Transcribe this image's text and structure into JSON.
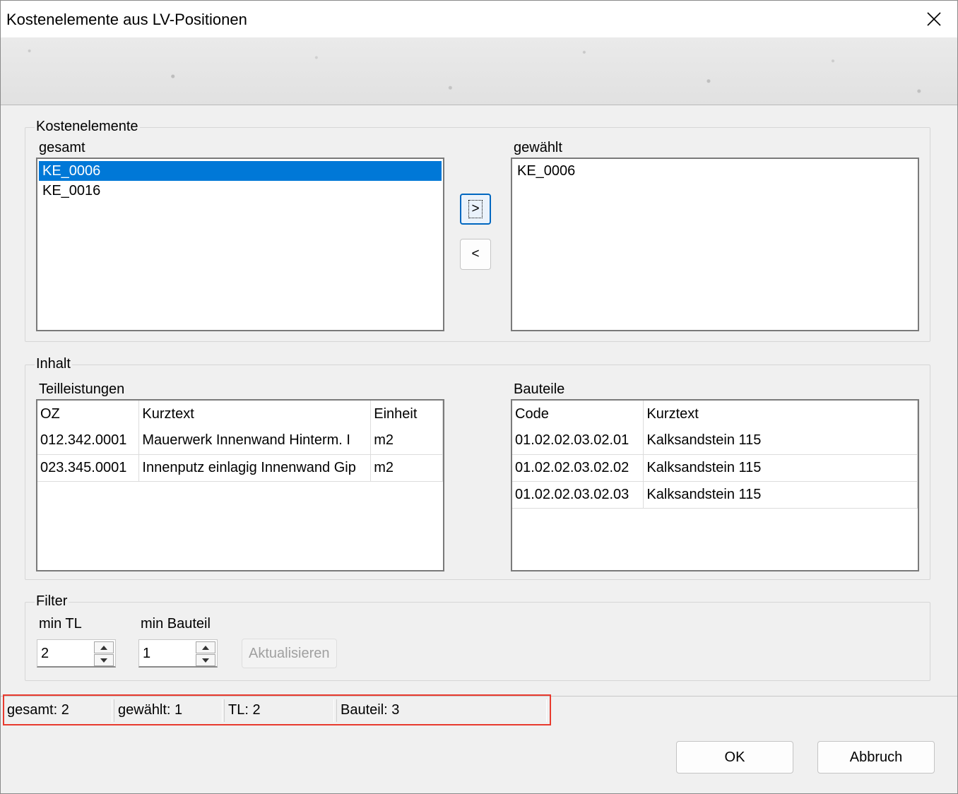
{
  "window": {
    "title": "Kostenelemente aus LV-Positionen"
  },
  "kostenelemente": {
    "group_label": "Kostenelemente",
    "gesamt_label": "gesamt",
    "gewaehlt_label": "gewählt",
    "gesamt_items": [
      "KE_0006",
      "KE_0016"
    ],
    "selected_index": 0,
    "gewaehlt_items": [
      "KE_0006"
    ],
    "add_label": ">",
    "remove_label": "<"
  },
  "inhalt": {
    "group_label": "Inhalt",
    "teilleistungen": {
      "label": "Teilleistungen",
      "columns": [
        "OZ",
        "Kurztext",
        "Einheit"
      ],
      "rows": [
        [
          "012.342.0001",
          "Mauerwerk Innenwand Hinterm. I",
          "m2"
        ],
        [
          "023.345.0001",
          "Innenputz einlagig Innenwand Gip",
          "m2"
        ]
      ]
    },
    "bauteile": {
      "label": "Bauteile",
      "columns": [
        "Code",
        "Kurztext"
      ],
      "rows": [
        [
          "01.02.02.03.02.01",
          "Kalksandstein 115"
        ],
        [
          "01.02.02.03.02.02",
          "Kalksandstein 115"
        ],
        [
          "01.02.02.03.02.03",
          "Kalksandstein 115"
        ]
      ]
    }
  },
  "filter": {
    "group_label": "Filter",
    "min_tl_label": "min TL",
    "min_tl_value": "2",
    "min_bauteil_label": "min Bauteil",
    "min_bauteil_value": "1",
    "refresh_label": "Aktualisieren"
  },
  "status": {
    "gesamt": "gesamt: 2",
    "gewaehlt": "gewählt: 1",
    "tl": "TL: 2",
    "bauteil": "Bauteil: 3"
  },
  "buttons": {
    "ok": "OK",
    "cancel": "Abbruch"
  },
  "colors": {
    "selection": "#0078d7",
    "highlight": "#e83a2e",
    "focus": "#0067c0"
  },
  "icons": {
    "close": "close-icon",
    "spin_up": "triangle-up-icon",
    "spin_down": "triangle-down-icon"
  }
}
